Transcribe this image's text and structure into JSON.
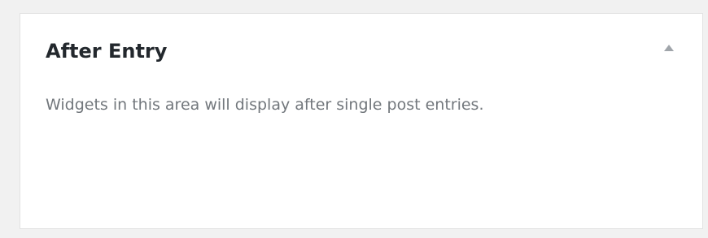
{
  "sidebar_area": {
    "title": "After Entry",
    "description": "Widgets in this area will display after single post entries.",
    "toggle_icon": "triangle-up-icon",
    "expanded": true
  },
  "colors": {
    "background": "#f1f1f1",
    "panel": "#ffffff",
    "title": "#23282d",
    "description": "#72777c",
    "icon": "#a0a5aa"
  }
}
